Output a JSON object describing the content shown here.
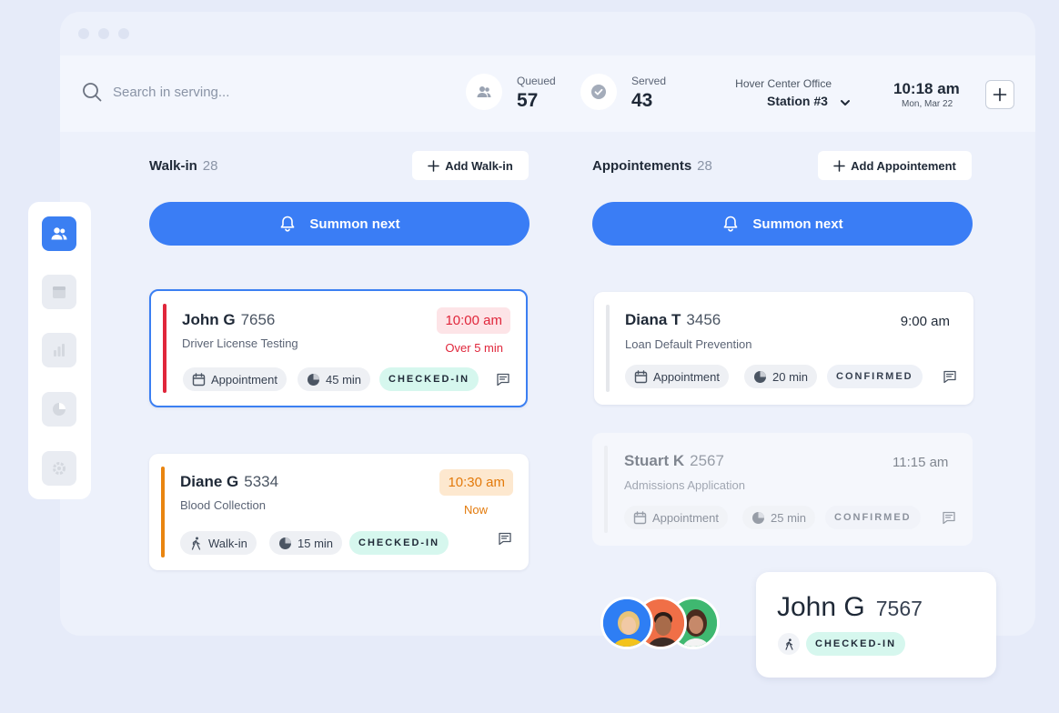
{
  "search": {
    "placeholder": "Search in serving..."
  },
  "stats": {
    "queued": {
      "label": "Queued",
      "value": "57"
    },
    "served": {
      "label": "Served",
      "value": "43"
    }
  },
  "office": {
    "name": "Hover Center Office",
    "station": "Station #3"
  },
  "clock": {
    "time": "10:18 am",
    "date": "Mon, Mar 22"
  },
  "sidebar": {
    "items": [
      {
        "icon": "users-icon",
        "active": true
      },
      {
        "icon": "calendar-icon",
        "active": false
      },
      {
        "icon": "bar-chart-icon",
        "active": false
      },
      {
        "icon": "pie-chart-icon",
        "active": false
      },
      {
        "icon": "gear-icon",
        "active": false
      }
    ]
  },
  "walkin": {
    "title": "Walk-in",
    "count": "28",
    "add_label": "Add Walk-in",
    "summon_label": "Summon next",
    "cards": [
      {
        "name": "John G",
        "number": "7656",
        "service": "Driver License Testing",
        "time": "10:00 am",
        "note": "Over 5 min",
        "type": "Appointment",
        "duration": "45 min",
        "status": "CHECKED-IN"
      },
      {
        "name": "Diane G",
        "number": "5334",
        "service": "Blood Collection",
        "time": "10:30 am",
        "note": "Now",
        "type": "Walk-in",
        "duration": "15 min",
        "status": "CHECKED-IN"
      }
    ]
  },
  "appointments": {
    "title": "Appointements",
    "count": "28",
    "add_label": "Add Appointement",
    "summon_label": "Summon next",
    "cards": [
      {
        "name": "Diana T",
        "number": "3456",
        "service": "Loan Default Prevention",
        "time": "9:00 am",
        "type": "Appointment",
        "duration": "20 min",
        "status": "CONFIRMED"
      },
      {
        "name": "Stuart K",
        "number": "2567",
        "service": "Admissions Application",
        "time": "11:15 am",
        "type": "Appointment",
        "duration": "25 min",
        "status": "CONFIRMED"
      }
    ]
  },
  "popup": {
    "name": "John G",
    "number": "7567",
    "status": "CHECKED-IN"
  },
  "colors": {
    "accent": "#3a7df5",
    "late": "#e0263b",
    "now": "#e98511",
    "checked_in_bg": "#d6f7ee"
  }
}
